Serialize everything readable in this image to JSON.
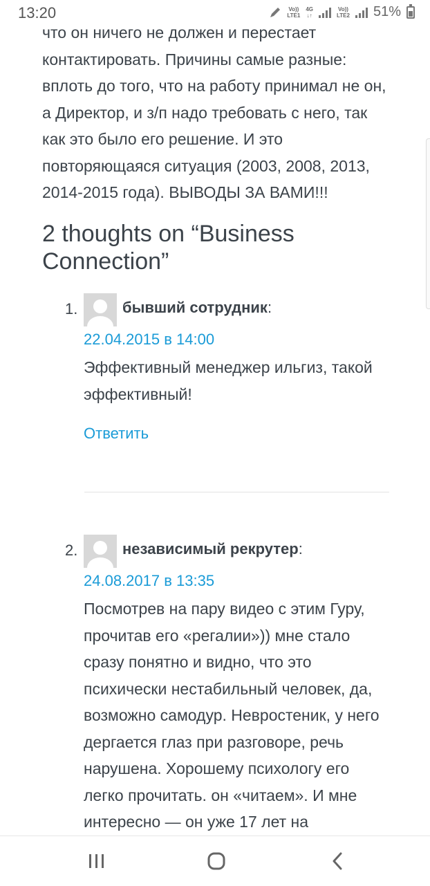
{
  "status": {
    "time": "13:20",
    "lte1_top": "Vo))",
    "lte1_bottom": "LTE1",
    "net_top": "4G",
    "net_bottom": "↓↑",
    "lte2_top": "Vo))",
    "lte2_bottom": "LTE2",
    "battery": "51%"
  },
  "article": {
    "text": "что он ничего не должен и перестает контактировать. Причины самые разные: вплоть до того, что на работу принимал не он, а Директор, и з/п надо требовать с него, так как это было его решение. И это повторяющаяся ситуация (2003, 2008, 2013, 2014-2015 года). ВЫВОДЫ ЗА ВАМИ!!!"
  },
  "comments_title": "2 thoughts on “Business Connection”",
  "comments": [
    {
      "number": "1.",
      "author": "бывший сотрудник",
      "says": ":",
      "date": "22.04.2015 в 14:00",
      "body": "Эффективный менеджер ильгиз, такой эффективный!",
      "reply": "Ответить"
    },
    {
      "number": "2.",
      "author": "независимый рекрутер",
      "says": ":",
      "date": "24.08.2017 в 13:35",
      "body": "Посмотрев на пару видео с этим Гуру, прочитав его «регалии»)) мне стало сразу понятно и видно, что это психически нестабильный человек, да, возможно самодур. Невростеник, у него дергается глаз при разговоре, речь нарушена. Хорошему психологу его легко прочитать. он «читаем». И мне интересно — он уже 17 лет на"
    }
  ],
  "icons": {
    "recent": "recent-apps-icon",
    "home": "home-icon",
    "back": "back-icon"
  },
  "colors": {
    "text": "#3c434a",
    "link": "#1a9bd7",
    "avatar": "#d8d8d8"
  }
}
